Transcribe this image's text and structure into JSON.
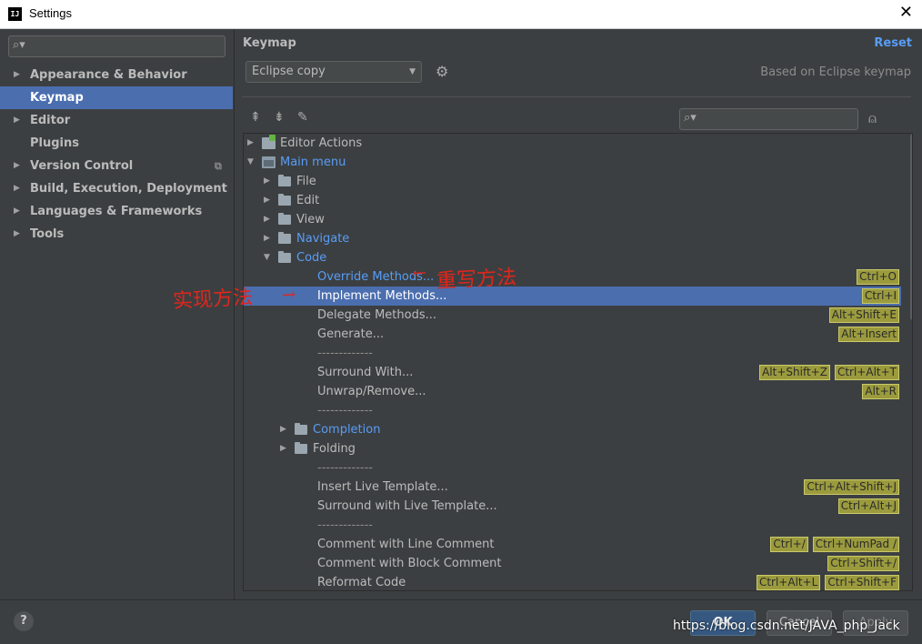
{
  "window": {
    "title": "Settings",
    "app_icon_text": "IJ"
  },
  "sidebar": {
    "search": {
      "placeholder": ""
    },
    "items": [
      {
        "label": "Appearance & Behavior",
        "has_arrow": true
      },
      {
        "label": "Keymap",
        "selected": true
      },
      {
        "label": "Editor",
        "has_arrow": true
      },
      {
        "label": "Plugins"
      },
      {
        "label": "Version Control",
        "has_arrow": true
      },
      {
        "label": "Build, Execution, Deployment",
        "has_arrow": true
      },
      {
        "label": "Languages & Frameworks",
        "has_arrow": true
      },
      {
        "label": "Tools",
        "has_arrow": true
      }
    ]
  },
  "main": {
    "heading": "Keymap",
    "reset_label": "Reset",
    "keymap_select": "Eclipse copy",
    "based_on": "Based on Eclipse keymap",
    "filter": {
      "placeholder": ""
    },
    "tree": [
      {
        "label": "Editor Actions",
        "icon": "actions-icon",
        "arrow": "right"
      },
      {
        "label": "Main menu",
        "icon": "menu-icon",
        "arrow": "down",
        "blue": true
      },
      {
        "label": "File",
        "icon": "folder-icon",
        "arrow": "right"
      },
      {
        "label": "Edit",
        "icon": "folder-icon",
        "arrow": "right"
      },
      {
        "label": "View",
        "icon": "folder-icon",
        "arrow": "right"
      },
      {
        "label": "Navigate",
        "icon": "folder-icon",
        "arrow": "right",
        "blue": true
      },
      {
        "label": "Code",
        "icon": "folder-icon",
        "arrow": "down",
        "blue": true
      },
      {
        "label": "Override Methods...",
        "blue": true,
        "shortcuts": [
          "Ctrl+O"
        ]
      },
      {
        "label": "Implement Methods...",
        "selected": true,
        "shortcuts": [
          "Ctrl+I"
        ]
      },
      {
        "label": "Delegate Methods...",
        "shortcuts": [
          "Alt+Shift+E"
        ]
      },
      {
        "label": "Generate...",
        "shortcuts": [
          "Alt+Insert"
        ]
      },
      {
        "label": "-------------",
        "dash": true
      },
      {
        "label": "Surround With...",
        "shortcuts": [
          "Alt+Shift+Z",
          "Ctrl+Alt+T"
        ]
      },
      {
        "label": "Unwrap/Remove...",
        "shortcuts": [
          "Alt+R"
        ]
      },
      {
        "label": "-------------",
        "dash": true
      },
      {
        "label": "Completion",
        "icon": "folder-icon",
        "arrow": "right",
        "blue": true
      },
      {
        "label": "Folding",
        "icon": "folder-icon",
        "arrow": "right"
      },
      {
        "label": "-------------",
        "dash": true
      },
      {
        "label": "Insert Live Template...",
        "shortcuts": [
          "Ctrl+Alt+Shift+J"
        ]
      },
      {
        "label": "Surround with Live Template...",
        "shortcuts": [
          "Ctrl+Alt+J"
        ]
      },
      {
        "label": "-------------",
        "dash": true
      },
      {
        "label": "Comment with Line Comment",
        "shortcuts": [
          "Ctrl+/",
          "Ctrl+NumPad /"
        ]
      },
      {
        "label": "Comment with Block Comment",
        "shortcuts": [
          "Ctrl+Shift+/"
        ]
      },
      {
        "label": "Reformat Code",
        "shortcuts": [
          "Ctrl+Alt+L",
          "Ctrl+Shift+F"
        ]
      }
    ]
  },
  "annotations": {
    "override": "重写方法",
    "implement": "实现方法"
  },
  "footer": {
    "help": "?",
    "ok": "OK",
    "cancel": "Cancel",
    "apply": "Apply",
    "watermark": "https://blog.csdn.net/JAVA_php_Jack"
  },
  "colors": {
    "accent": "#4b6eaf",
    "link": "#589df6",
    "shortcut_bg": "#9b9b3e",
    "annotation": "#e0261c"
  }
}
